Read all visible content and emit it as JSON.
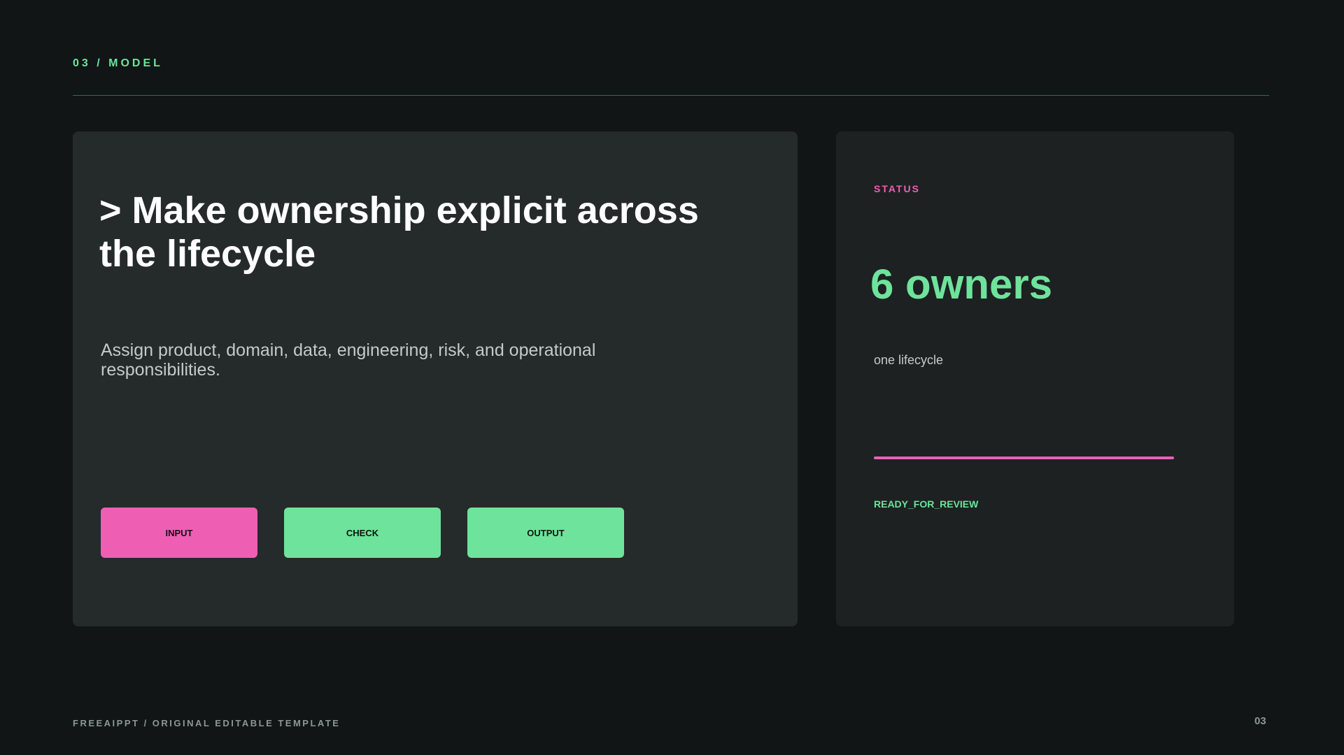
{
  "header": {
    "section_label": "03 / MODEL"
  },
  "main_card": {
    "headline": "> Make ownership explicit across the lifecycle",
    "description": "Assign product, domain, data, engineering, risk, and operational responsibilities.",
    "steps": [
      {
        "label": "INPUT",
        "color": "#ee5fb4"
      },
      {
        "label": "CHECK",
        "color": "#6ee39b"
      },
      {
        "label": "OUTPUT",
        "color": "#6ee39b"
      }
    ]
  },
  "status_card": {
    "label": "STATUS",
    "metric": "6 owners",
    "caption": "one lifecycle",
    "progress": 1.0,
    "state": "READY_FOR_REVIEW"
  },
  "footer": {
    "label": "FREEAIPPT / ORIGINAL EDITABLE TEMPLATE",
    "page_number": "03"
  },
  "colors": {
    "background": "#111516",
    "accent_green": "#6ee39b",
    "accent_pink": "#ee5fb4",
    "card": "#252a2b",
    "card_secondary": "#1d2122"
  }
}
